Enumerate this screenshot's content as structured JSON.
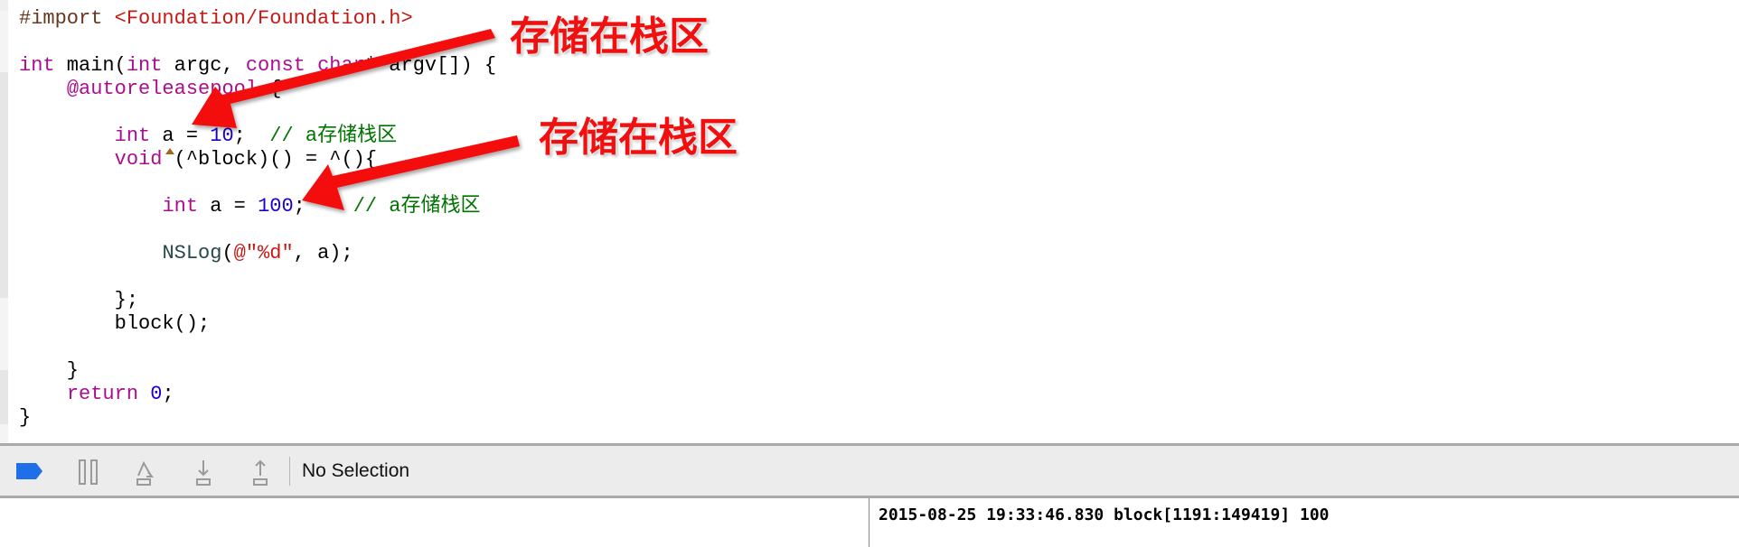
{
  "editor": {
    "lines": [
      [
        [
          "#import ",
          "macro"
        ],
        [
          "<Foundation/Foundation.h>",
          "str"
        ]
      ],
      [],
      [
        [
          "int",
          "kw"
        ],
        [
          " main(",
          "plain"
        ],
        [
          "int",
          "kw"
        ],
        [
          " argc, ",
          "plain"
        ],
        [
          "const",
          "kw"
        ],
        [
          " ",
          "plain"
        ],
        [
          "char",
          "kw"
        ],
        [
          "* argv[]) {",
          "plain"
        ]
      ],
      [
        [
          "    ",
          "plain"
        ],
        [
          "@autoreleasepool",
          "kw"
        ],
        [
          " {",
          "plain"
        ]
      ],
      [],
      [
        [
          "        ",
          "plain"
        ],
        [
          "int",
          "kw"
        ],
        [
          " a = ",
          "plain"
        ],
        [
          "10",
          "num"
        ],
        [
          ";  ",
          "plain"
        ],
        [
          "// a存储栈区",
          "cmt"
        ]
      ],
      [
        [
          "        ",
          "plain"
        ],
        [
          "void",
          "kw"
        ],
        [
          " (^block)() = ^(){",
          "plain"
        ]
      ],
      [],
      [
        [
          "            ",
          "plain"
        ],
        [
          "int",
          "kw"
        ],
        [
          " a = ",
          "plain"
        ],
        [
          "100",
          "num"
        ],
        [
          ";    ",
          "plain"
        ],
        [
          "// a存储栈区",
          "cmt"
        ]
      ],
      [],
      [
        [
          "            ",
          "plain"
        ],
        [
          "NSLog",
          "fn"
        ],
        [
          "(",
          "plain"
        ],
        [
          "@\"%d\"",
          "str"
        ],
        [
          ", a);",
          "plain"
        ]
      ],
      [],
      [
        [
          "        };",
          "plain"
        ]
      ],
      [
        [
          "        block();",
          "plain"
        ]
      ],
      [],
      [
        [
          "    }",
          "plain"
        ]
      ],
      [
        [
          "    ",
          "plain"
        ],
        [
          "return",
          "kw"
        ],
        [
          " ",
          "plain"
        ],
        [
          "0",
          "num"
        ],
        [
          ";",
          "plain"
        ]
      ],
      [
        [
          "}",
          "plain"
        ]
      ]
    ]
  },
  "annotations": [
    {
      "label": "存储在栈区",
      "color": "#f01010"
    },
    {
      "label": "存储在栈区",
      "color": "#f01010"
    }
  ],
  "debug_toolbar": {
    "icons": [
      "breakpoints-toggle-icon",
      "pause-icon",
      "step-over-icon",
      "step-into-icon",
      "step-out-icon"
    ],
    "accent": "#1f6fe8",
    "selection_label": "No Selection"
  },
  "console": {
    "output": "2015-08-25 19:33:46.830 block[1191:149419] 100"
  }
}
